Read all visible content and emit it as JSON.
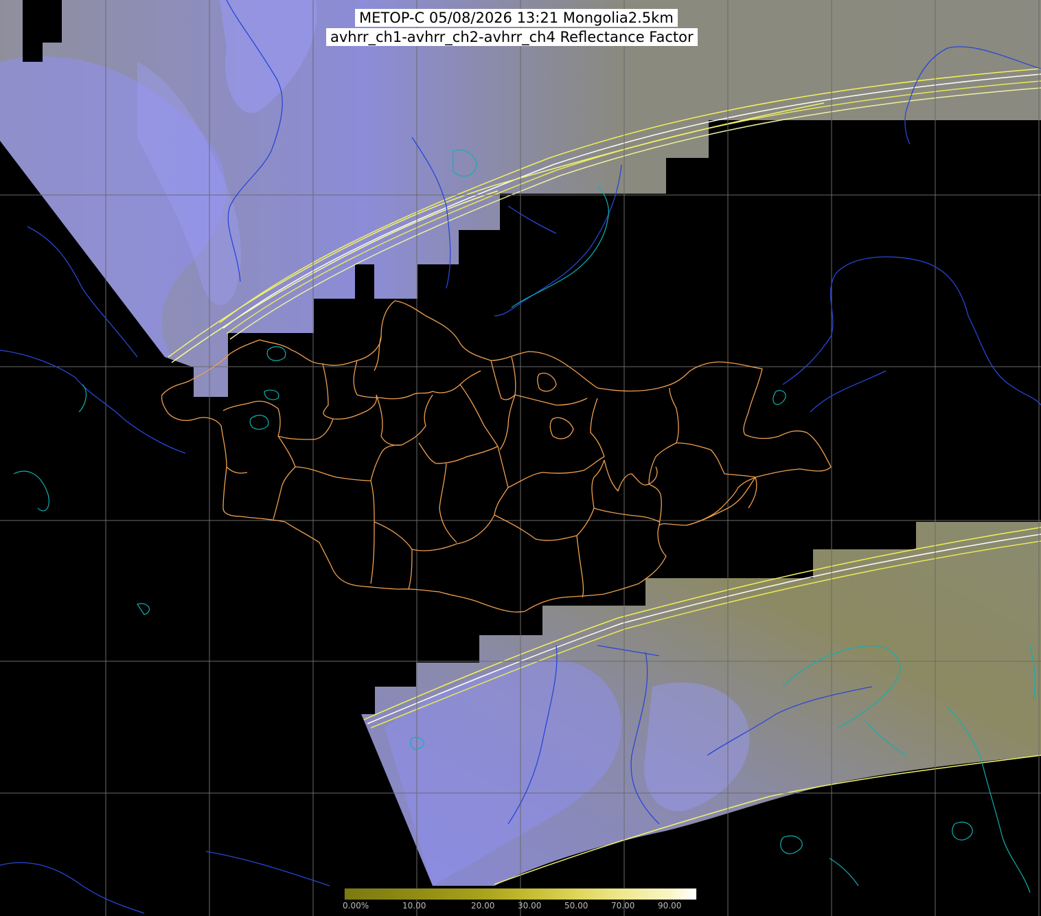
{
  "title": {
    "line1": "METOP-C 05/08/2026 13:21 Mongolia2.5km",
    "line2": "avhrr_ch1-avhrr_ch2-avhrr_ch4 Reflectance Factor"
  },
  "colorbar": {
    "labels": [
      "0.00%",
      "10.00",
      "20.00",
      "30.00",
      "50.00",
      "70.00",
      "90.00"
    ],
    "colors": [
      "#7a7a10",
      "#8f8b14",
      "#a8a21c",
      "#c4bc30",
      "#ddd55a",
      "#eee88e",
      "#f8f5c4",
      "#ffffff"
    ]
  },
  "colors": {
    "background": "#000000",
    "cloud": "#8c8cf0",
    "land": "#8a8a6a",
    "border": "#f0a050",
    "river": "#2846d8",
    "coast": "#10b0b0",
    "grid": "#707070"
  }
}
